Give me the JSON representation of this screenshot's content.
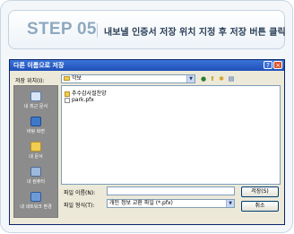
{
  "header": {
    "step": "STEP 05",
    "description": "내보낼 인증서 저장 위치 지정 후 저장 버튼 클릭"
  },
  "dialog": {
    "title": "다른 이름으로 저장",
    "title_buttons": {
      "help": "?",
      "close": "×"
    },
    "save_in_label": "저장 위치(I):",
    "save_in_value": "악보",
    "places": [
      {
        "label": "내 최근 문서",
        "icon": "recent-documents-icon"
      },
      {
        "label": "바탕 화면",
        "icon": "desktop-icon"
      },
      {
        "label": "내 문서",
        "icon": "my-documents-icon"
      },
      {
        "label": "내 컴퓨터",
        "icon": "my-computer-icon"
      },
      {
        "label": "내 네트워크 환경",
        "icon": "network-places-icon"
      }
    ],
    "files": [
      {
        "name": "추수감사절찬양",
        "type": "folder"
      },
      {
        "name": "park.pfx",
        "type": "pfx"
      }
    ],
    "filename_label": "파일 이름(N):",
    "filename_value": "",
    "filetype_label": "파일 형식(T):",
    "filetype_value": "개인 정보 교환 파일 (*.pfx)",
    "save_button": "저장(S)",
    "cancel_button": "취소"
  },
  "colors": {
    "step_text": "#8ea9c0",
    "titlebar": "#2a5fc8",
    "dialog_bg": "#ece9d8"
  }
}
